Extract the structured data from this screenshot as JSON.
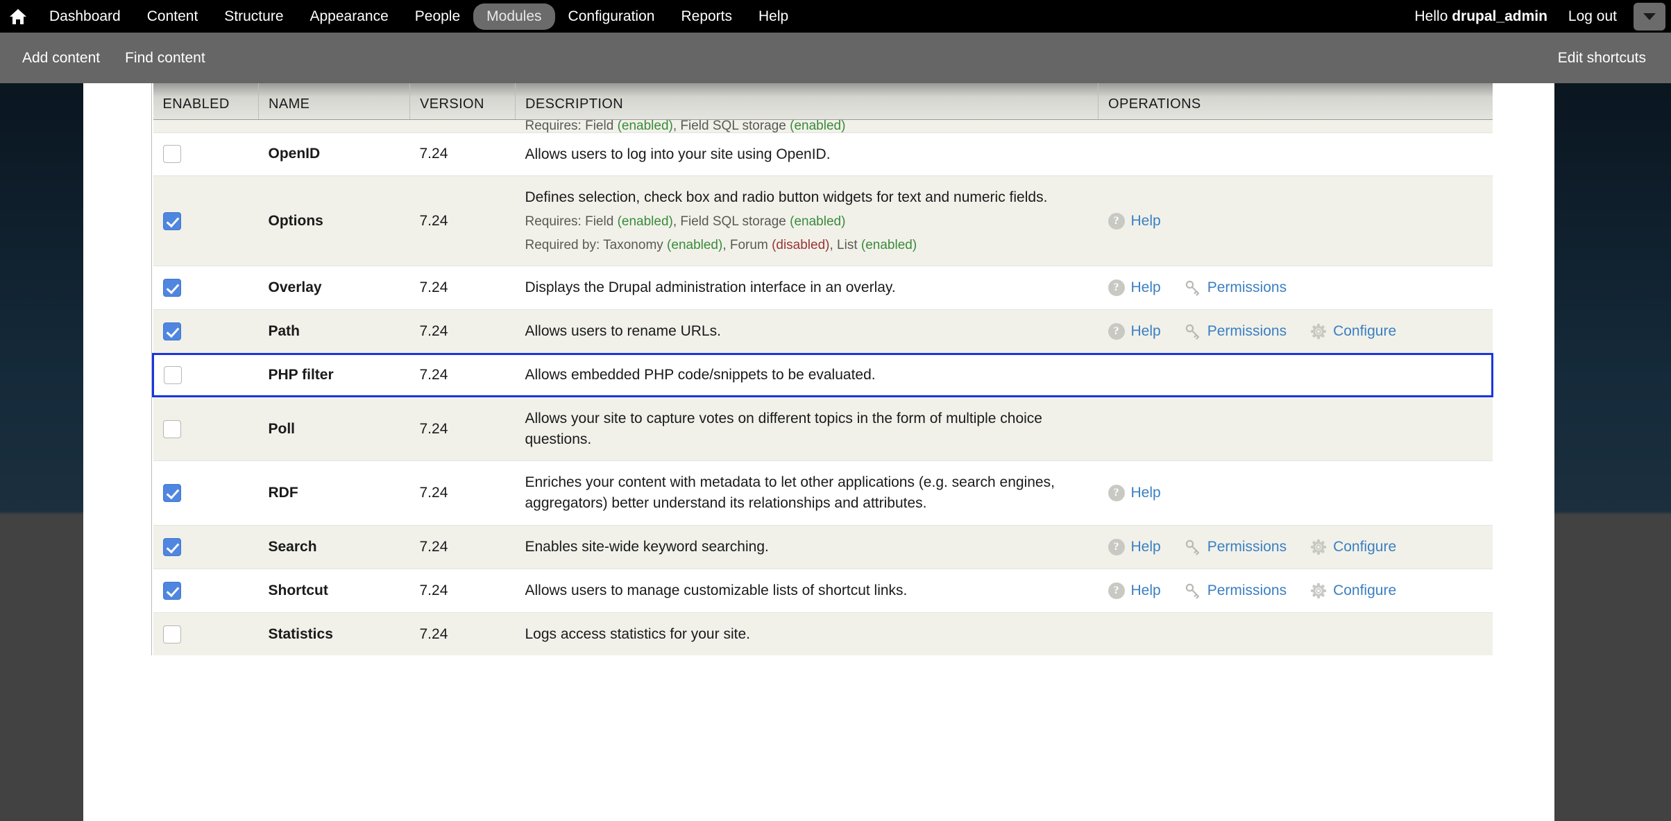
{
  "toolbar": {
    "home_icon": "home-icon",
    "items": [
      {
        "label": "Dashboard",
        "active": false
      },
      {
        "label": "Content",
        "active": false
      },
      {
        "label": "Structure",
        "active": false
      },
      {
        "label": "Appearance",
        "active": false
      },
      {
        "label": "People",
        "active": false
      },
      {
        "label": "Modules",
        "active": true
      },
      {
        "label": "Configuration",
        "active": false
      },
      {
        "label": "Reports",
        "active": false
      },
      {
        "label": "Help",
        "active": false
      }
    ],
    "greeting_prefix": "Hello ",
    "username": "drupal_admin",
    "logout_label": "Log out",
    "toggle_icon": "chevron-down-icon"
  },
  "shortcuts": {
    "links": [
      {
        "label": "Add content"
      },
      {
        "label": "Find content"
      }
    ],
    "edit_label": "Edit shortcuts"
  },
  "table": {
    "headers": {
      "enabled": "ENABLED",
      "name": "NAME",
      "version": "VERSION",
      "description": "DESCRIPTION",
      "operations": "OPERATIONS"
    },
    "clipped_top_row": {
      "requires_prefix": "Requires: ",
      "requires_parts": [
        {
          "text": "Field ",
          "state": null
        },
        {
          "text": "(enabled)",
          "state": "enabled"
        },
        {
          "text": ", Field SQL storage ",
          "state": null
        },
        {
          "text": "(enabled)",
          "state": "enabled"
        }
      ]
    },
    "rows": [
      {
        "enabled": false,
        "name": "OpenID",
        "version": "7.24",
        "description": "Allows users to log into your site using OpenID.",
        "requires": null,
        "required_by": null,
        "operations": [],
        "highlight": false,
        "stripe": "even"
      },
      {
        "enabled": true,
        "name": "Options",
        "version": "7.24",
        "description": "Defines selection, check box and radio button widgets for text and numeric fields.",
        "requires": {
          "label": "Requires: ",
          "parts": [
            {
              "text": "Field ",
              "state": null
            },
            {
              "text": "(enabled)",
              "state": "enabled"
            },
            {
              "text": ", Field SQL storage ",
              "state": null
            },
            {
              "text": "(enabled)",
              "state": "enabled"
            }
          ]
        },
        "required_by": {
          "label": "Required by: ",
          "parts": [
            {
              "text": "Taxonomy ",
              "state": null
            },
            {
              "text": "(enabled)",
              "state": "enabled"
            },
            {
              "text": ", Forum ",
              "state": null
            },
            {
              "text": "(disabled)",
              "state": "disabled"
            },
            {
              "text": ", List ",
              "state": null
            },
            {
              "text": "(enabled)",
              "state": "enabled"
            }
          ]
        },
        "operations": [
          {
            "icon": "help-icon",
            "label": "Help"
          }
        ],
        "highlight": false,
        "stripe": "odd"
      },
      {
        "enabled": true,
        "name": "Overlay",
        "version": "7.24",
        "description": "Displays the Drupal administration interface in an overlay.",
        "requires": null,
        "required_by": null,
        "operations": [
          {
            "icon": "help-icon",
            "label": "Help"
          },
          {
            "icon": "key-icon",
            "label": "Permissions"
          }
        ],
        "highlight": false,
        "stripe": "even"
      },
      {
        "enabled": true,
        "name": "Path",
        "version": "7.24",
        "description": "Allows users to rename URLs.",
        "requires": null,
        "required_by": null,
        "operations": [
          {
            "icon": "help-icon",
            "label": "Help"
          },
          {
            "icon": "key-icon",
            "label": "Permissions"
          },
          {
            "icon": "gear-icon",
            "label": "Configure"
          }
        ],
        "highlight": false,
        "stripe": "odd"
      },
      {
        "enabled": false,
        "name": "PHP filter",
        "version": "7.24",
        "description": "Allows embedded PHP code/snippets to be evaluated.",
        "requires": null,
        "required_by": null,
        "operations": [],
        "highlight": true,
        "stripe": "even"
      },
      {
        "enabled": false,
        "name": "Poll",
        "version": "7.24",
        "description": "Allows your site to capture votes on different topics in the form of multiple choice questions.",
        "requires": null,
        "required_by": null,
        "operations": [],
        "highlight": false,
        "stripe": "odd"
      },
      {
        "enabled": true,
        "name": "RDF",
        "version": "7.24",
        "description": "Enriches your content with metadata to let other applications (e.g. search engines, aggregators) better understand its relationships and attributes.",
        "requires": null,
        "required_by": null,
        "operations": [
          {
            "icon": "help-icon",
            "label": "Help"
          }
        ],
        "highlight": false,
        "stripe": "even"
      },
      {
        "enabled": true,
        "name": "Search",
        "version": "7.24",
        "description": "Enables site-wide keyword searching.",
        "requires": null,
        "required_by": null,
        "operations": [
          {
            "icon": "help-icon",
            "label": "Help"
          },
          {
            "icon": "key-icon",
            "label": "Permissions"
          },
          {
            "icon": "gear-icon",
            "label": "Configure"
          }
        ],
        "highlight": false,
        "stripe": "odd"
      },
      {
        "enabled": true,
        "name": "Shortcut",
        "version": "7.24",
        "description": "Allows users to manage customizable lists of shortcut links.",
        "requires": null,
        "required_by": null,
        "operations": [
          {
            "icon": "help-icon",
            "label": "Help"
          },
          {
            "icon": "key-icon",
            "label": "Permissions"
          },
          {
            "icon": "gear-icon",
            "label": "Configure"
          }
        ],
        "highlight": false,
        "stripe": "even"
      },
      {
        "enabled": false,
        "name": "Statistics",
        "version": "7.24",
        "description": "Logs access statistics for your site.",
        "requires": null,
        "required_by": null,
        "operations": [],
        "highlight": false,
        "stripe": "odd"
      }
    ]
  },
  "colors": {
    "toolbar_bg": "#000000",
    "shortcut_bg": "#666666",
    "active_tab_bg": "#6b6b6b",
    "link_blue": "#3a7fc1",
    "checkbox_on": "#4f86e0",
    "highlight_border": "#1a34e0",
    "dep_enabled": "#3a8b3a",
    "dep_disabled": "#9b3434",
    "row_stripe": "#f1f1ea",
    "backdrop_navy": "#152a3a",
    "backdrop_gray": "#424242"
  }
}
